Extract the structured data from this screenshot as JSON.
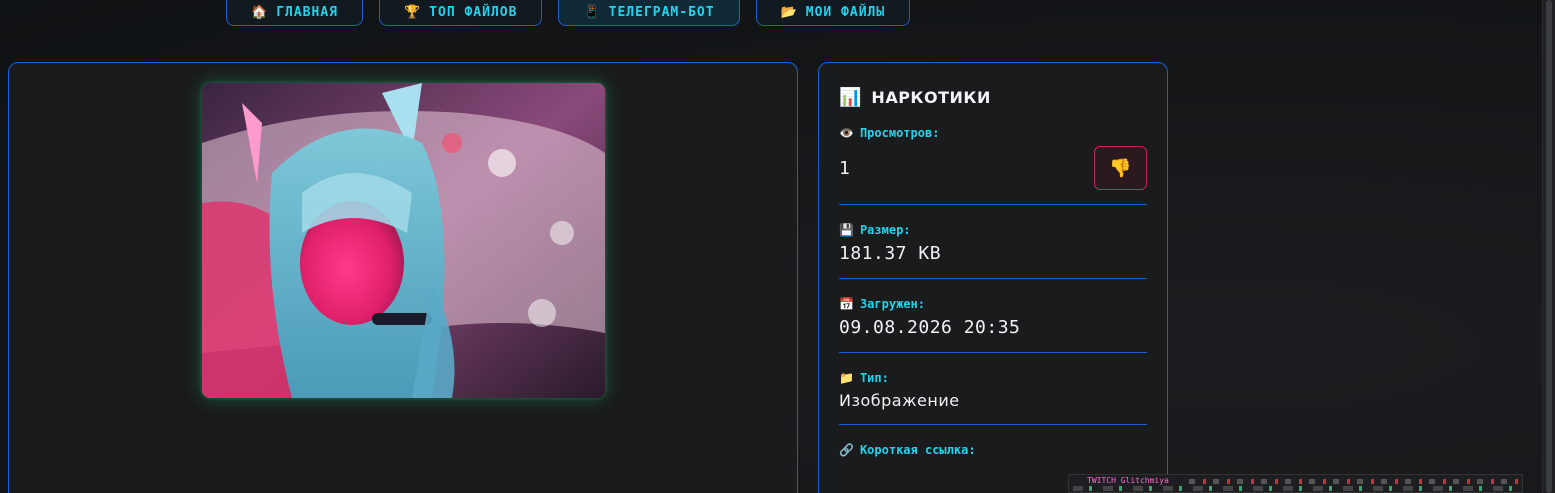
{
  "nav": [
    {
      "icon": "🏠",
      "label": "ГЛАВНАЯ"
    },
    {
      "icon": "🏆",
      "label": "ТОП ФАЙЛОВ"
    },
    {
      "icon": "📱",
      "label": "ТЕЛЕГРАМ-БОТ"
    },
    {
      "icon": "📂",
      "label": "МОИ ФАЙЛЫ"
    }
  ],
  "file": {
    "title_icon": "📊",
    "title": "НАРКОТИКИ",
    "views_icon": "👁️",
    "views_label": "Просмотров:",
    "views_value": "1",
    "dislike_icon": "👎",
    "size_icon": "💾",
    "size_label": "Размер:",
    "size_value": "181.37 KB",
    "uploaded_icon": "📅",
    "uploaded_label": "Загружен:",
    "uploaded_value": "09.08.2026 20:35",
    "type_icon": "📁",
    "type_label": "Тип:",
    "type_value": "Изображение",
    "link_icon": "🔗",
    "link_label": "Короткая ссылка:"
  },
  "overlay": {
    "tag": "TWITCH Glitchmiya"
  },
  "colors": {
    "accent": "#22d3ee",
    "border": "#1a5fd0",
    "danger": "#c0285a"
  }
}
